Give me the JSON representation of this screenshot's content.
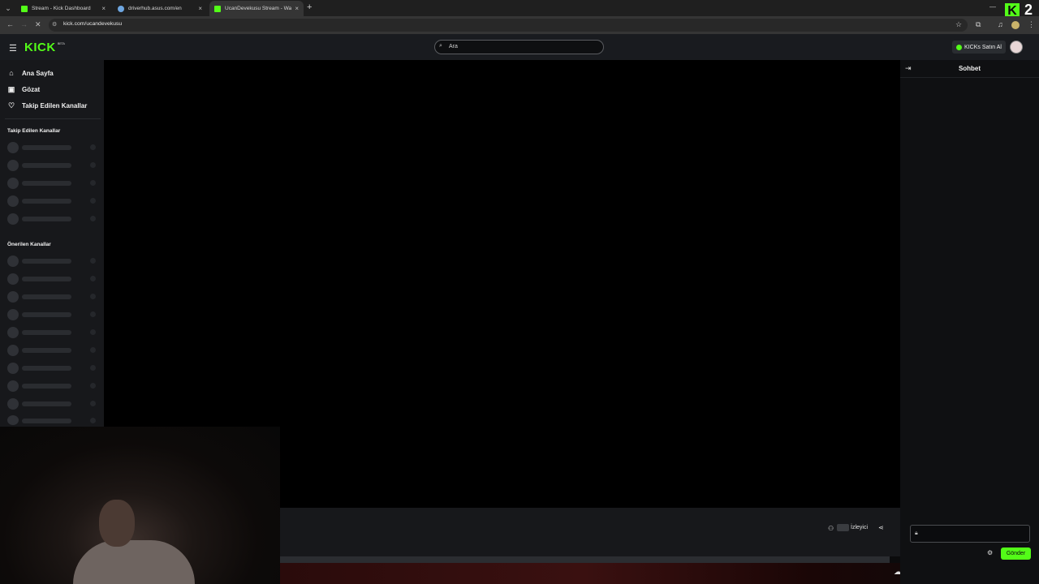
{
  "browser": {
    "tabs": [
      {
        "title": "Stream - Kick Dashboard",
        "active": false
      },
      {
        "title": "driverhub.asus.com/en",
        "active": false
      },
      {
        "title": "UcanDevekusu Stream - Watch",
        "active": true
      }
    ],
    "url": "kick.com/ucandevekusu",
    "overlay_badge": "2"
  },
  "header": {
    "logo": "KICK",
    "logo_tag": "BETA",
    "search_placeholder": "Ara",
    "buy_kicks": "KICKs Satın Al"
  },
  "sidebar": {
    "nav": [
      {
        "label": "Ana Sayfa",
        "icon": "home-icon"
      },
      {
        "label": "Gözat",
        "icon": "browse-icon"
      },
      {
        "label": "Takip Edilen Kanallar",
        "icon": "heart-icon"
      }
    ],
    "followed_title": "Takip Edilen Kanallar",
    "recommended_title": "Önerilen Kanallar"
  },
  "player": {
    "viewer_label": "İzleyici"
  },
  "chat": {
    "title": "Sohbet",
    "send_label": "Gönder"
  },
  "colors": {
    "accent": "#53fc18",
    "background": "#0b0b0c",
    "panel": "#17181b"
  }
}
